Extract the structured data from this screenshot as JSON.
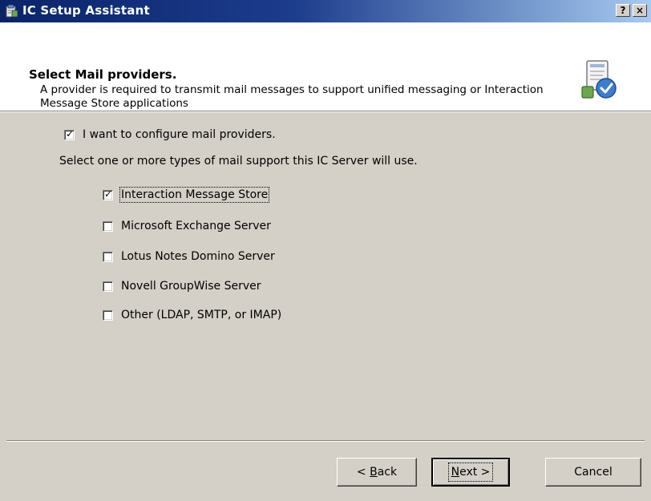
{
  "window": {
    "title": "IC Setup Assistant",
    "help_button": "?",
    "close_button": "×"
  },
  "header": {
    "title": "Select Mail providers.",
    "description": "A provider is required to transmit mail messages to support unified messaging or Interaction Message Store applications",
    "icon": "setup-wizard-icon"
  },
  "main": {
    "configure": {
      "label": "I want to configure mail providers.",
      "checked": true
    },
    "instruction": "Select one or more types of mail support this IC Server will use.",
    "providers": [
      {
        "label": "Interaction Message Store",
        "checked": true
      },
      {
        "label": "Microsoft Exchange Server",
        "checked": false
      },
      {
        "label": "Lotus Notes Domino Server",
        "checked": false
      },
      {
        "label": "Novell GroupWise Server",
        "checked": false
      },
      {
        "label": "Other (LDAP, SMTP, or IMAP)",
        "checked": false
      }
    ]
  },
  "footer": {
    "back_prefix": "< ",
    "back_key": "B",
    "back_rest": "ack",
    "next_key": "N",
    "next_rest": "ext >",
    "cancel_label": "Cancel"
  },
  "colors": {
    "titlebar_start": "#0a246a",
    "titlebar_end": "#a6caf0",
    "dialog_bg": "#d4d0c8",
    "header_bg": "#ffffff"
  }
}
